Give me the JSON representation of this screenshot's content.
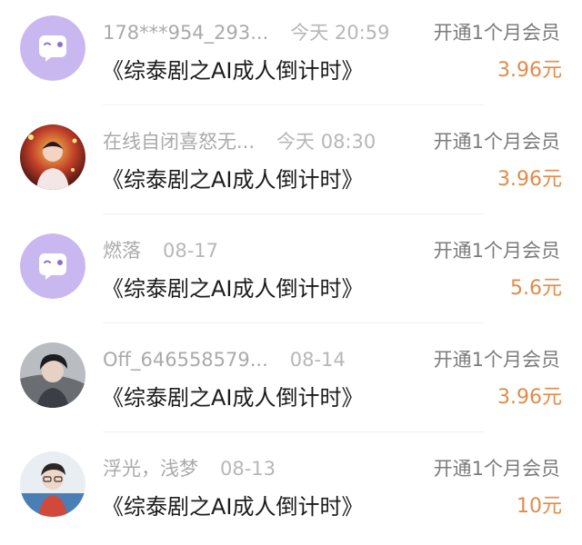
{
  "orders": [
    {
      "user": "178***954_293...",
      "time": "今天 20:59",
      "title": "《综泰剧之AI成人倒计时》",
      "action": "开通1个月会员",
      "price": "3.96元",
      "avatar": "default-ghost-avatar"
    },
    {
      "user": "在线自闭喜怒无...",
      "time": "今天 08:30",
      "title": "《综泰剧之AI成人倒计时》",
      "action": "开通1个月会员",
      "price": "3.96元",
      "avatar": "photo-avatar"
    },
    {
      "user": "燃落",
      "time": "08-17",
      "title": "《综泰剧之AI成人倒计时》",
      "action": "开通1个月会员",
      "price": "5.6元",
      "avatar": "default-ghost-avatar"
    },
    {
      "user": "Off_646558579...",
      "time": "08-14",
      "title": "《综泰剧之AI成人倒计时》",
      "action": "开通1个月会员",
      "price": "3.96元",
      "avatar": "photo-avatar"
    },
    {
      "user": "浮光，浅梦",
      "time": "08-13",
      "title": "《综泰剧之AI成人倒计时》",
      "action": "开通1个月会员",
      "price": "10元",
      "avatar": "photo-avatar"
    }
  ],
  "colors": {
    "default_avatar_bg": "#c9b8ef",
    "price": "#e08b4a",
    "username": "#aaaaaa",
    "title": "#1c1c1c"
  }
}
